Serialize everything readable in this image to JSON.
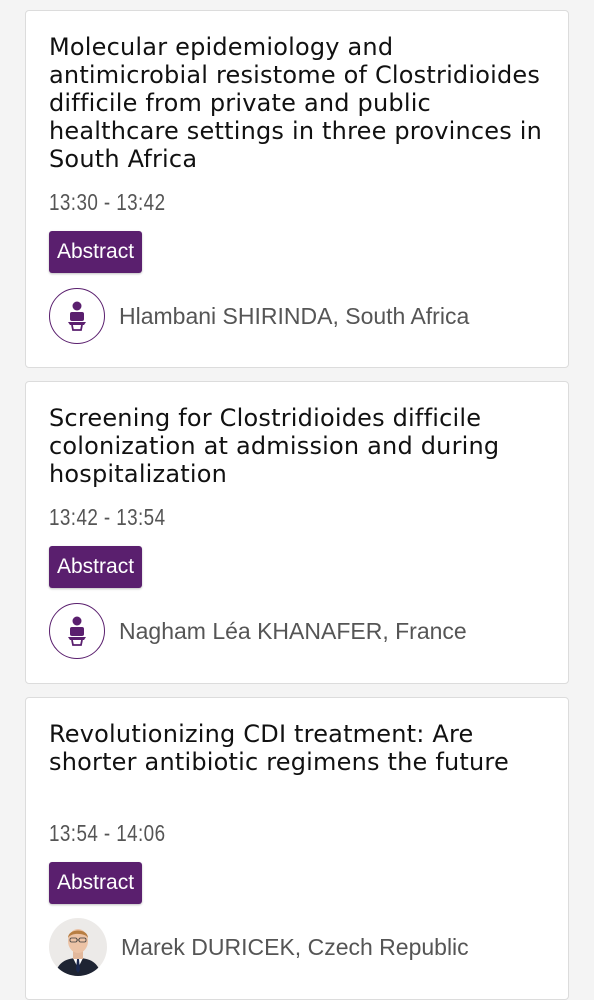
{
  "sessions": [
    {
      "title": "Molecular epidemiology and antimicrobial resistome of Clostridioides difficile from private and public healthcare settings in three provinces in South Africa",
      "time": "13:30 - 13:42",
      "button_label": "Abstract",
      "speaker": "Hlambani SHIRINDA, South Africa",
      "avatar": "speaker-podium-icon"
    },
    {
      "title": "Screening for Clostridioides difficile colonization at admission and during hospitalization",
      "time": "13:42 - 13:54",
      "button_label": "Abstract",
      "speaker": "Nagham Léa KHANAFER, France",
      "avatar": "speaker-podium-icon"
    },
    {
      "title": "Revolutionizing CDI treatment: Are shorter antibiotic regimens the future",
      "time": "13:54 - 14:06",
      "button_label": "Abstract",
      "speaker": "Marek DURICEK, Czech Republic",
      "avatar": "speaker-photo"
    }
  ],
  "colors": {
    "accent": "#5a1f6e",
    "card_border": "#dcdcdc",
    "background": "#f4f4f4",
    "title_text": "#111111",
    "meta_text": "#555555"
  }
}
